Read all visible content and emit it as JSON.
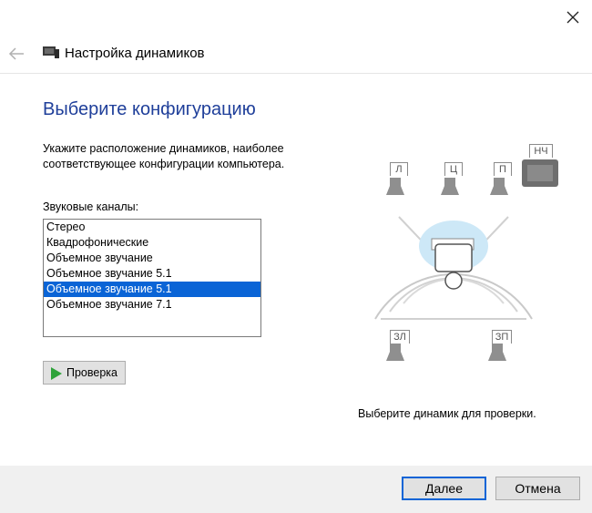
{
  "window": {
    "title": "Настройка динамиков"
  },
  "page": {
    "heading": "Выберите конфигурацию",
    "description": "Укажите расположение динамиков, наиболее соответствующее конфигурации компьютера.",
    "channels_label": "Звуковые каналы:",
    "channels": [
      {
        "label": "Стерео",
        "selected": false
      },
      {
        "label": "Квадрофонические",
        "selected": false
      },
      {
        "label": "Объемное звучание",
        "selected": false
      },
      {
        "label": "Объемное звучание 5.1",
        "selected": false
      },
      {
        "label": "Объемное звучание 5.1",
        "selected": true
      },
      {
        "label": "Объемное звучание 7.1",
        "selected": false
      }
    ],
    "test_button": "Проверка",
    "hint": "Выберите динамик для проверки."
  },
  "speakers": {
    "front_left": "Л",
    "center": "Ц",
    "front_right": "П",
    "subwoofer": "НЧ",
    "rear_left": "ЗЛ",
    "rear_right": "ЗП"
  },
  "footer": {
    "next": "Далее",
    "cancel": "Отмена"
  },
  "colors": {
    "accent": "#0a64d6",
    "heading": "#1f3f9a",
    "play": "#2ea23a"
  }
}
